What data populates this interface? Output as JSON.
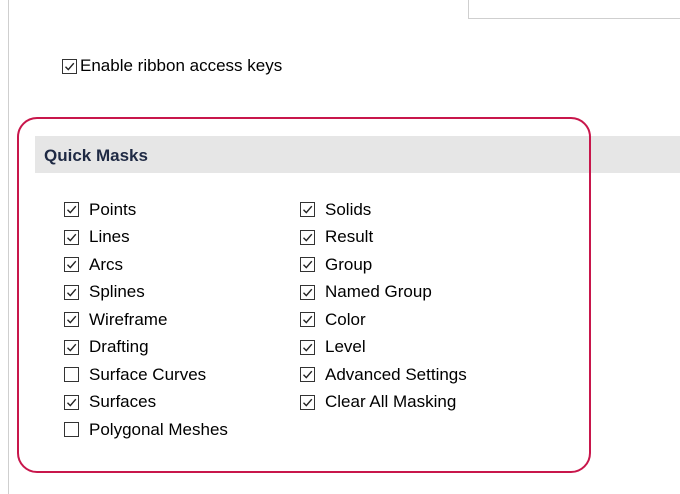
{
  "ribbon": {
    "label": "Enable ribbon access keys",
    "checked": true
  },
  "quick_masks": {
    "title": "Quick Masks",
    "column1": [
      {
        "label": "Points",
        "checked": true
      },
      {
        "label": "Lines",
        "checked": true
      },
      {
        "label": "Arcs",
        "checked": true
      },
      {
        "label": "Splines",
        "checked": true
      },
      {
        "label": "Wireframe",
        "checked": true
      },
      {
        "label": "Drafting",
        "checked": true
      },
      {
        "label": "Surface Curves",
        "checked": false
      },
      {
        "label": "Surfaces",
        "checked": true
      },
      {
        "label": "Polygonal Meshes",
        "checked": false
      }
    ],
    "column2": [
      {
        "label": "Solids",
        "checked": true
      },
      {
        "label": "Result",
        "checked": true
      },
      {
        "label": "Group",
        "checked": true
      },
      {
        "label": "Named Group",
        "checked": true
      },
      {
        "label": "Color",
        "checked": true
      },
      {
        "label": "Level",
        "checked": true
      },
      {
        "label": "Advanced Settings",
        "checked": true
      },
      {
        "label": "Clear All Masking",
        "checked": true
      }
    ]
  },
  "colors": {
    "highlight": "#c8164b",
    "header_band": "#e6e6e6",
    "header_text": "#1f2a44"
  }
}
